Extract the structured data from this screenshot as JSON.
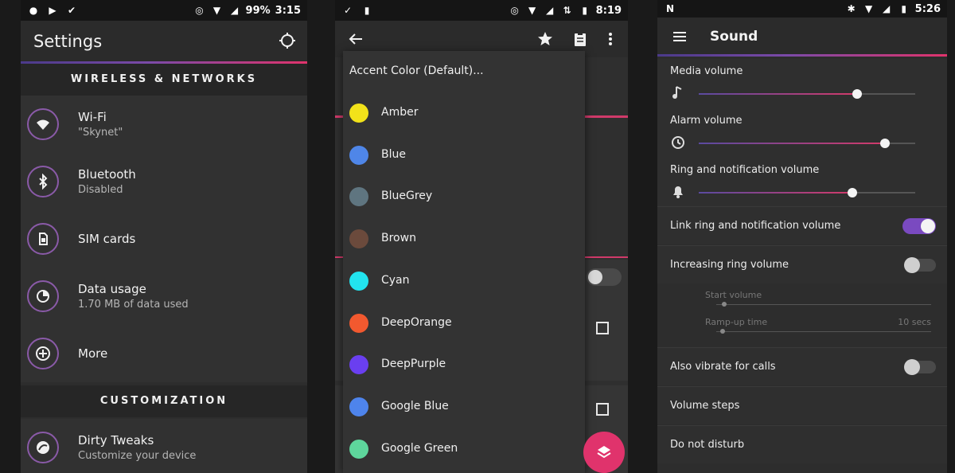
{
  "settings_screen": {
    "status": {
      "battery_text": "99%",
      "time": "3:15"
    },
    "title": "Settings",
    "sections": {
      "wireless": "WIRELESS & NETWORKS",
      "customization": "CUSTOMIZATION"
    },
    "items": [
      {
        "label": "Wi-Fi",
        "sub": "\"Skynet\"",
        "icon": "wifi-icon"
      },
      {
        "label": "Bluetooth",
        "sub": "Disabled",
        "icon": "bluetooth-icon"
      },
      {
        "label": "SIM cards",
        "sub": "",
        "icon": "sim-card-icon"
      },
      {
        "label": "Data usage",
        "sub": "1.70 MB of data used",
        "icon": "data-usage-icon"
      },
      {
        "label": "More",
        "sub": "",
        "icon": "plus-icon"
      },
      {
        "label": "Dirty Tweaks",
        "sub": "Customize your device",
        "icon": "tweaks-icon"
      }
    ]
  },
  "accent_screen": {
    "status": {
      "time": "8:19"
    },
    "dialog_title": "Accent Color (Default)...",
    "colors": [
      {
        "name": "Amber",
        "hex": "#f2e21a"
      },
      {
        "name": "Blue",
        "hex": "#4f86e8"
      },
      {
        "name": "BlueGrey",
        "hex": "#5f7580"
      },
      {
        "name": "Brown",
        "hex": "#6b4a3c"
      },
      {
        "name": "Cyan",
        "hex": "#22e4ef"
      },
      {
        "name": "DeepOrange",
        "hex": "#f2592f"
      },
      {
        "name": "DeepPurple",
        "hex": "#6a3ff0"
      },
      {
        "name": "Google Blue",
        "hex": "#4e84ec"
      },
      {
        "name": "Google Green",
        "hex": "#5ed69c"
      }
    ]
  },
  "sound_screen": {
    "status": {
      "time": "5:26"
    },
    "title": "Sound",
    "volumes": [
      {
        "label": "Media volume",
        "icon": "music-note-icon",
        "level": 0.73
      },
      {
        "label": "Alarm volume",
        "icon": "alarm-clock-icon",
        "level": 0.86
      },
      {
        "label": "Ring and notification volume",
        "icon": "bell-icon",
        "level": 0.71
      }
    ],
    "link_ring": {
      "label": "Link ring and notification volume",
      "on": true
    },
    "increasing_ring": {
      "label": "Increasing ring volume",
      "on": false
    },
    "start_volume_label": "Start volume",
    "ramp_up_label": "Ramp-up time",
    "ramp_up_value": "10 secs",
    "vibrate": {
      "label": "Also vibrate for calls",
      "on": false
    },
    "volume_steps": "Volume steps",
    "do_not_disturb": "Do not disturb"
  },
  "colors": {
    "accent_pink": "#e0336c",
    "accent_purple": "#7a4ac0"
  }
}
